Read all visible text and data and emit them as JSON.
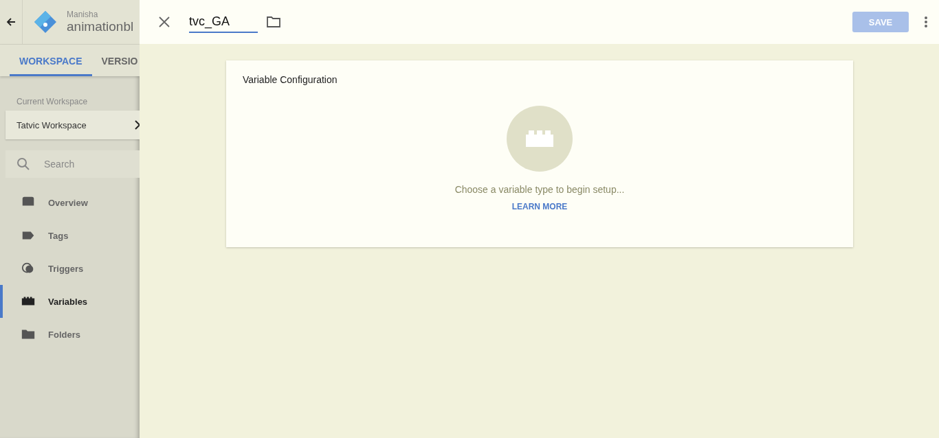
{
  "app_header": {
    "account": "Manisha",
    "container": "animationbl"
  },
  "tabs": [
    {
      "label": "WORKSPACE",
      "selected": true
    },
    {
      "label": "VERSIO",
      "selected": false
    }
  ],
  "workspace": {
    "label": "Current Workspace",
    "name": "Tatvic Workspace"
  },
  "search": {
    "placeholder": "Search"
  },
  "nav": [
    {
      "label": "Overview",
      "kind": "overview",
      "selected": false
    },
    {
      "label": "Tags",
      "kind": "tags",
      "selected": false
    },
    {
      "label": "Triggers",
      "kind": "triggers",
      "selected": false
    },
    {
      "label": "Variables",
      "kind": "variables",
      "selected": true
    },
    {
      "label": "Folders",
      "kind": "folders",
      "selected": false
    }
  ],
  "editor": {
    "name": "tvc_GA",
    "save": {
      "label": "SAVE",
      "disabled": true
    }
  },
  "card": {
    "title": "Variable Configuration",
    "message": "Choose a variable type to begin setup...",
    "link": "LEARN MORE"
  }
}
